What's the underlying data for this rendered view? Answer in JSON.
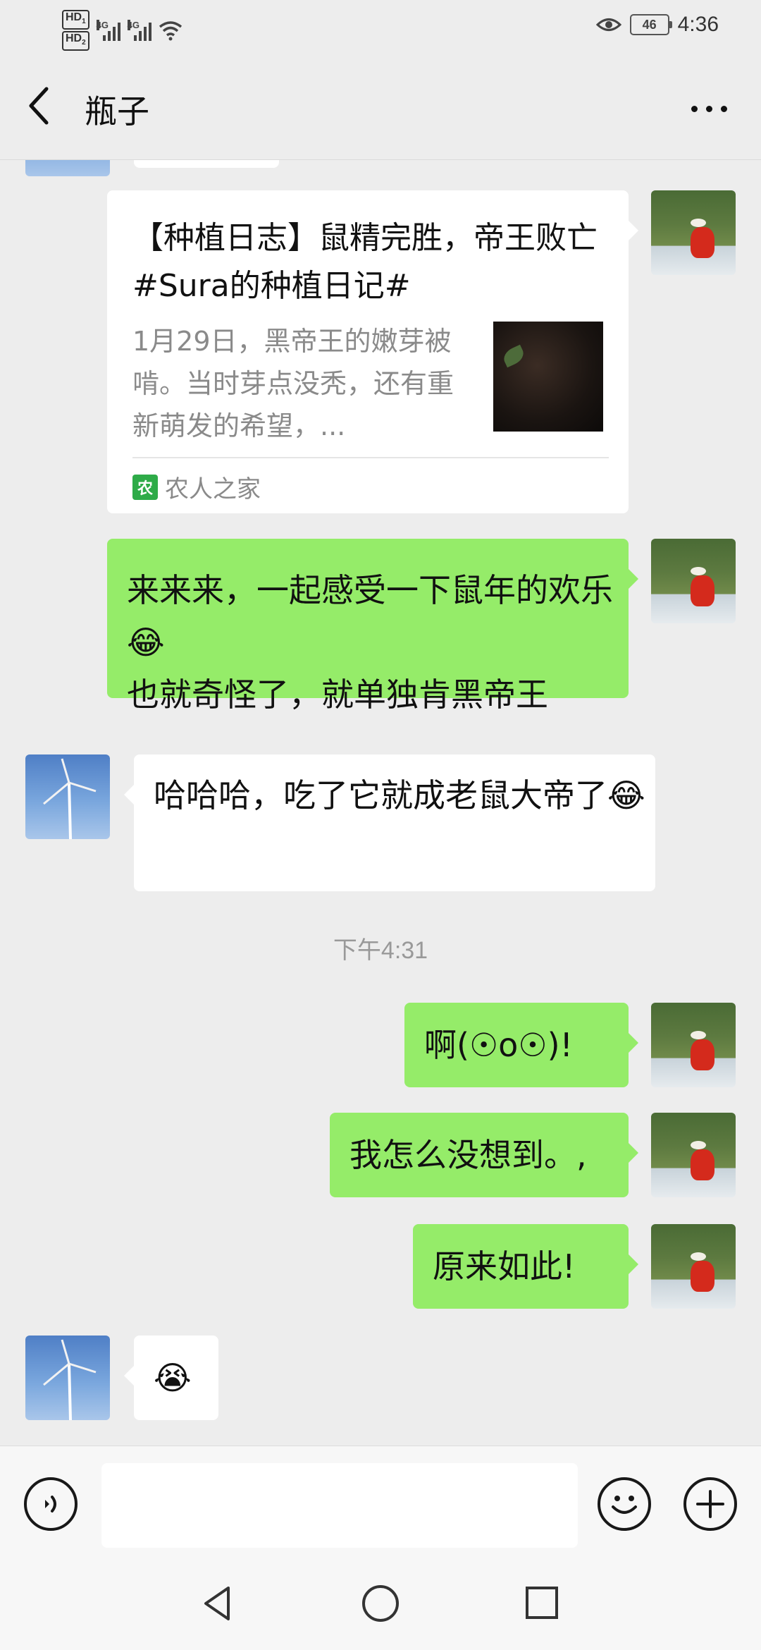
{
  "status_bar": {
    "sim1_label": "HD",
    "sim1_num": "1",
    "sim2_label": "HD",
    "sim2_num": "2",
    "network1": "4G",
    "network2": "4G",
    "battery": "46",
    "time": "4:36",
    "icons": [
      "eye-icon",
      "wifi-icon",
      "signal-icon",
      "battery-icon"
    ]
  },
  "header": {
    "title": "瓶子",
    "back_icon": "chevron-left-icon",
    "more_icon": "more-dots-icon"
  },
  "messages": {
    "card": {
      "title": "【种植日志】鼠精完胜，帝王败亡 #Sura的种植日记#",
      "description": "1月29日，黑帝王的嫩芽被啃。当时芽点没秃，还有重新萌发的希望，...",
      "source": "农人之家",
      "source_icon": "app-logo-icon"
    },
    "m1": "来来来，一起感受一下鼠年的欢乐😂\n也就奇怪了，就单独肯黑帝王",
    "m2": "哈哈哈，吃了它就成老鼠大帝了😂",
    "time_divider": "下午4:31",
    "m3": "啊(☉o☉)!",
    "m4": "我怎么没想到。,",
    "m5": "原来如此!",
    "m6": "😭"
  },
  "input_bar": {
    "voice_icon": "voice-icon",
    "emoji_icon": "emoji-icon",
    "plus_icon": "plus-icon",
    "placeholder": ""
  },
  "nav_bar": {
    "icons": [
      "back-triangle-icon",
      "home-circle-icon",
      "recents-square-icon"
    ]
  },
  "colors": {
    "background": "#EDEDED",
    "sent_bubble": "#95EC69",
    "received_bubble": "#FFFFFF"
  }
}
